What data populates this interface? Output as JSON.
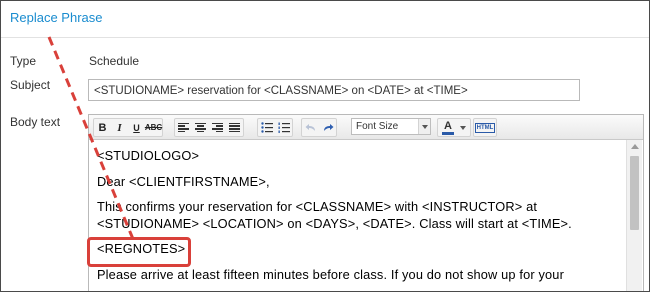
{
  "header": {
    "link": "Replace Phrase"
  },
  "form": {
    "type_label": "Type",
    "type_value": "Schedule",
    "subject_label": "Subject",
    "subject_value": "<STUDIONAME> reservation for <CLASSNAME> on <DATE> at <TIME>",
    "body_label": "Body text"
  },
  "toolbar": {
    "bold": "B",
    "italic": "I",
    "underline": "U",
    "strike": "ABC",
    "font_size": "Font Size",
    "font_color_glyph": "A",
    "html": "HTML"
  },
  "body": {
    "lines": [
      "<STUDIOLOGO>",
      "Dear <CLIENTFIRSTNAME>,",
      "This confirms your reservation for <CLASSNAME> with <INSTRUCTOR> at",
      "<STUDIONAME> <LOCATION> on <DAYS>, <DATE>. Class will start at <TIME>.",
      "<REGNOTES>",
      "Please arrive at least fifteen minutes before class. If you do not show up for your"
    ]
  },
  "annotation": {
    "color": "#d9403a",
    "highlighted_phrase": "<REGNOTES>"
  },
  "colors": {
    "link": "#1a8ccf",
    "border": "#b9b9b9"
  }
}
